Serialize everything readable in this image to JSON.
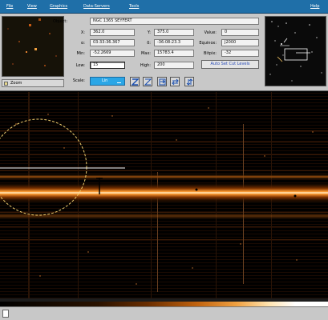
{
  "menubar": {
    "items": [
      "File",
      "View",
      "Graphics",
      "Data-Servers",
      "Tools"
    ],
    "help": "Help"
  },
  "panel": {
    "object_label": "Object:",
    "object_value": "NGC 1365 SEYFERT",
    "x_label": "X:",
    "x_value": "362.0",
    "y_label": "Y:",
    "y_value": "375.0",
    "value_label": "Value:",
    "value_value": "0",
    "ra_label": "α:",
    "ra_value": "03:33:36.367",
    "dec_label": "δ:",
    "dec_value": "-36:08:23.3",
    "equinox_label": "Equinox:",
    "equinox_value": "J2000",
    "min_label": "Min:",
    "min_value": "-52.2669",
    "max_label": "Max:",
    "max_value": "15783.4",
    "bitpix_label": "Bitpix:",
    "bitpix_value": "-32",
    "low_label": "Low:",
    "low_value": "15",
    "high_label": "High:",
    "high_value": "200",
    "autoset_label": "Auto Set Cut Levels",
    "scale_label": "Scale:",
    "scale_value": "Lin",
    "zoom_label": "Zoom"
  },
  "colors": {
    "menubar_bg": "#1f6fa8",
    "panel_bg": "#c8c8c8",
    "accent": "#2aa6e6",
    "colormap": "heat"
  },
  "icons": [
    "zoom-in-icon",
    "zoom-out-icon",
    "rotate-icon",
    "flip-x-icon",
    "flip-y-icon"
  ]
}
